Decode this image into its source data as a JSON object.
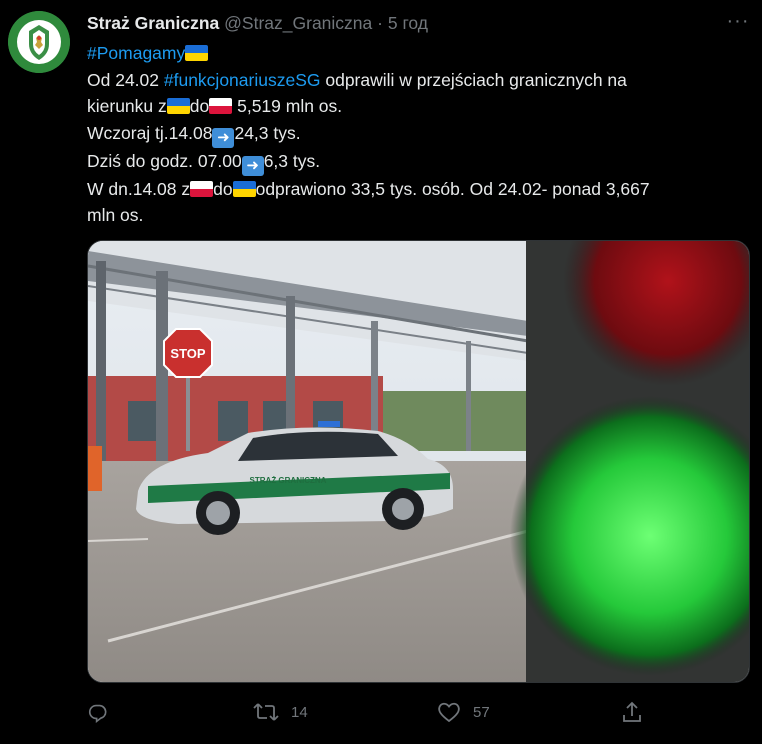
{
  "author": {
    "name": "Straż Graniczna",
    "handle": "@Straz_Graniczna",
    "separator": "·",
    "time": "5 год"
  },
  "tweet": {
    "hashtag1": "#Pomagamy",
    "line2_a": "Od 24.02 ",
    "hashtag2": "#funkcjonariuszeSG",
    "line2_b": " odprawili w przejściach granicznych na",
    "line3_a": "kierunku z",
    "line3_b": "do",
    "line3_c": " 5,519 mln os.",
    "line4_a": "Wczoraj tj.14.08",
    "line4_b": "24,3 tys.",
    "line5_a": "Dziś do godz. 07.00",
    "line5_b": "6,3 tys.",
    "line6_a": "W dn.14.08 z",
    "line6_b": "do",
    "line6_c": "odprawiono 33,5 tys. osób. Od 24.02- ponad 3,667",
    "line7": "mln os."
  },
  "actions": {
    "retweets": "14",
    "likes": "57"
  },
  "icons": {
    "reply": "reply-icon",
    "retweet": "retweet-icon",
    "like": "heart-icon",
    "share": "share-icon",
    "more": "more-icon"
  },
  "photo": {
    "stop_sign": "STOP",
    "car_lettering": "STRAŻ GRANICZNA"
  },
  "colors": {
    "background": "#000000",
    "text": "#e7e9ea",
    "secondary": "#71767b",
    "link": "#1d9bf0"
  }
}
